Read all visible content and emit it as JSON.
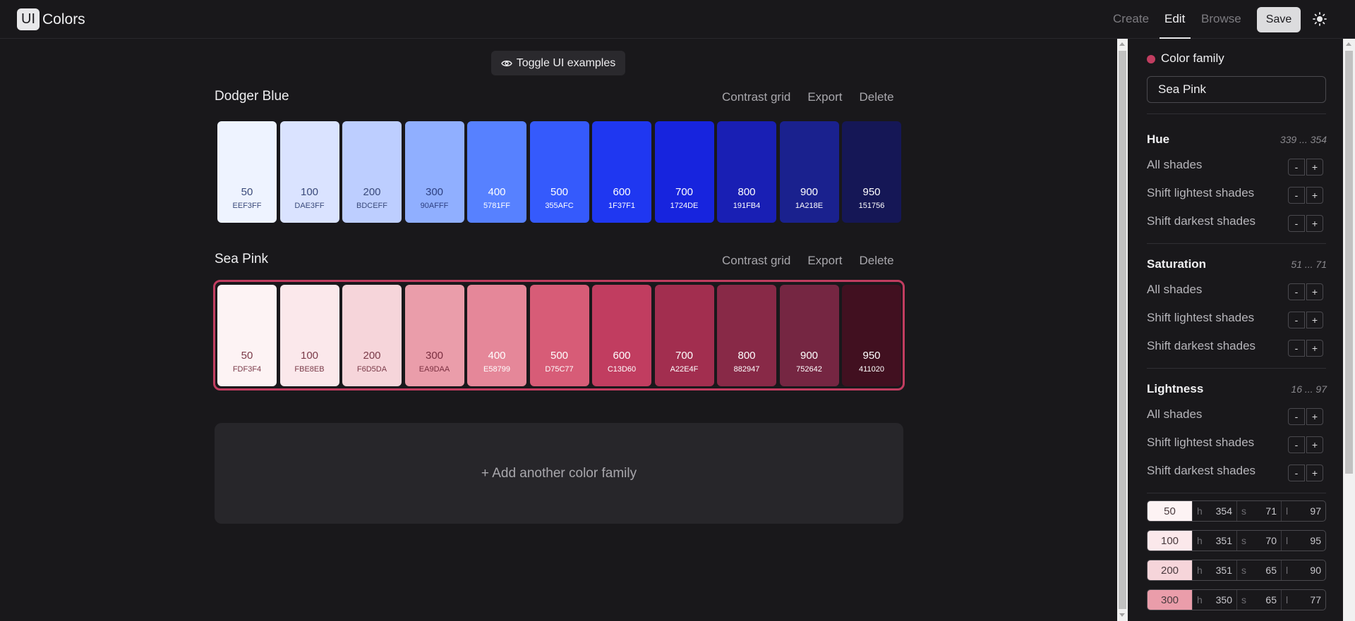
{
  "header": {
    "logo_box": "UI",
    "logo_text": "Colors",
    "nav": {
      "create": "Create",
      "edit": "Edit",
      "browse": "Browse"
    },
    "save_label": "Save",
    "theme_icon": "sun-icon"
  },
  "main": {
    "toggle_label": "Toggle UI examples",
    "families": [
      {
        "name": "Dodger Blue",
        "actions": {
          "contrast": "Contrast grid",
          "export": "Export",
          "delete": "Delete"
        },
        "swatches": [
          {
            "shade": "50",
            "hex": "EEF3FF",
            "color": "#EEF3FF",
            "text": "#3a4a7a"
          },
          {
            "shade": "100",
            "hex": "DAE3FF",
            "color": "#DAE3FF",
            "text": "#3a4a7a"
          },
          {
            "shade": "200",
            "hex": "BDCEFF",
            "color": "#BDCEFF",
            "text": "#3a4a7a"
          },
          {
            "shade": "300",
            "hex": "90AFFF",
            "color": "#90AFFF",
            "text": "#2d3f80"
          },
          {
            "shade": "400",
            "hex": "5781FF",
            "color": "#5781FF",
            "text": "#ffffff"
          },
          {
            "shade": "500",
            "hex": "355AFC",
            "color": "#355AFC",
            "text": "#ffffff"
          },
          {
            "shade": "600",
            "hex": "1F37F1",
            "color": "#1F37F1",
            "text": "#ffffff"
          },
          {
            "shade": "700",
            "hex": "1724DE",
            "color": "#1724DE",
            "text": "#ffffff"
          },
          {
            "shade": "800",
            "hex": "191FB4",
            "color": "#191FB4",
            "text": "#ffffff"
          },
          {
            "shade": "900",
            "hex": "1A218E",
            "color": "#1A218E",
            "text": "#ffffff"
          },
          {
            "shade": "950",
            "hex": "151756",
            "color": "#151756",
            "text": "#ffffff"
          }
        ]
      },
      {
        "name": "Sea Pink",
        "actions": {
          "contrast": "Contrast grid",
          "export": "Export",
          "delete": "Delete"
        },
        "swatches": [
          {
            "shade": "50",
            "hex": "FDF3F4",
            "color": "#FDF3F4",
            "text": "#7a3a48"
          },
          {
            "shade": "100",
            "hex": "FBE8EB",
            "color": "#FBE8EB",
            "text": "#7a3a48"
          },
          {
            "shade": "200",
            "hex": "F6D5DA",
            "color": "#F6D5DA",
            "text": "#7a3a48"
          },
          {
            "shade": "300",
            "hex": "EA9DAA",
            "color": "#EA9DAA",
            "text": "#7a2f40"
          },
          {
            "shade": "400",
            "hex": "E58799",
            "color": "#E58799",
            "text": "#ffffff"
          },
          {
            "shade": "500",
            "hex": "D75C77",
            "color": "#D75C77",
            "text": "#ffffff"
          },
          {
            "shade": "600",
            "hex": "C13D60",
            "color": "#C13D60",
            "text": "#ffffff"
          },
          {
            "shade": "700",
            "hex": "A22E4F",
            "color": "#A22E4F",
            "text": "#ffffff"
          },
          {
            "shade": "800",
            "hex": "882947",
            "color": "#882947",
            "text": "#ffffff"
          },
          {
            "shade": "900",
            "hex": "752642",
            "color": "#752642",
            "text": "#ffffff"
          },
          {
            "shade": "950",
            "hex": "411020",
            "color": "#411020",
            "text": "#ffffff"
          }
        ]
      }
    ],
    "add_family_label": "+ Add another color family"
  },
  "sidebar": {
    "family_label": "Color family",
    "family_color": "#C13D60",
    "family_name": "Sea Pink",
    "sections": [
      {
        "title": "Hue",
        "range": "339 ... 354",
        "rows": [
          "All shades",
          "Shift lightest shades",
          "Shift darkest shades"
        ]
      },
      {
        "title": "Saturation",
        "range": "51 ... 71",
        "rows": [
          "All shades",
          "Shift lightest shades",
          "Shift darkest shades"
        ]
      },
      {
        "title": "Lightness",
        "range": "16 ... 97",
        "rows": [
          "All shades",
          "Shift lightest shades",
          "Shift darkest shades"
        ]
      }
    ],
    "stepper": {
      "minus": "-",
      "plus": "+"
    },
    "shade_rows": [
      {
        "shade": "50",
        "color": "#FDF3F4",
        "h": "354",
        "s": "71",
        "l": "97"
      },
      {
        "shade": "100",
        "color": "#FBE8EB",
        "h": "351",
        "s": "70",
        "l": "95"
      },
      {
        "shade": "200",
        "color": "#F6D5DA",
        "h": "351",
        "s": "65",
        "l": "90"
      },
      {
        "shade": "300",
        "color": "#EA9DAA",
        "h": "350",
        "s": "65",
        "l": "77"
      }
    ],
    "hsl_keys": {
      "h": "h",
      "s": "s",
      "l": "l"
    }
  }
}
